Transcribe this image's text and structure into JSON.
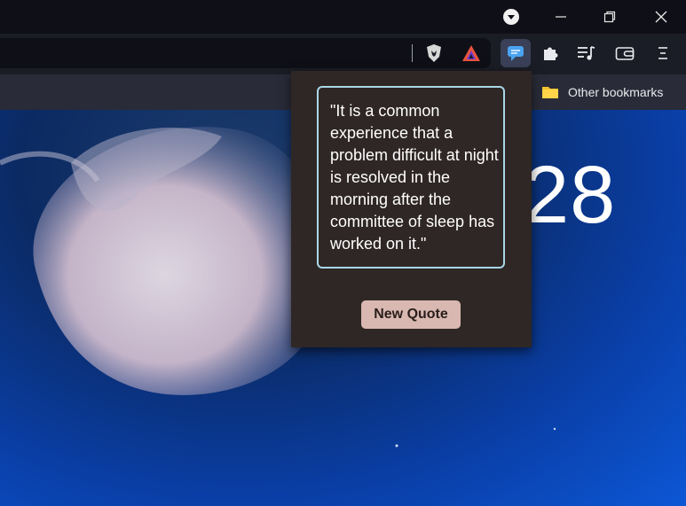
{
  "window": {
    "controls": [
      "minimize",
      "restore",
      "close"
    ]
  },
  "toolbar": {
    "icons": [
      "brave-shield-icon",
      "brave-rewards-icon",
      "quote-extension-icon",
      "extensions-puzzle-icon",
      "playlist-icon",
      "wallet-icon",
      "menu-icon"
    ]
  },
  "bookmarks": {
    "other_label": "Other bookmarks"
  },
  "newtab": {
    "clock_partial": "28"
  },
  "popup": {
    "quote": "\"It is a common experience that a problem difficult at night is resolved in the morning after the committee of sleep has worked on it.\"",
    "button_label": "New Quote",
    "colors": {
      "background": "#2f2725",
      "border": "#a9d7e8",
      "button": "#d8b8b0"
    }
  }
}
